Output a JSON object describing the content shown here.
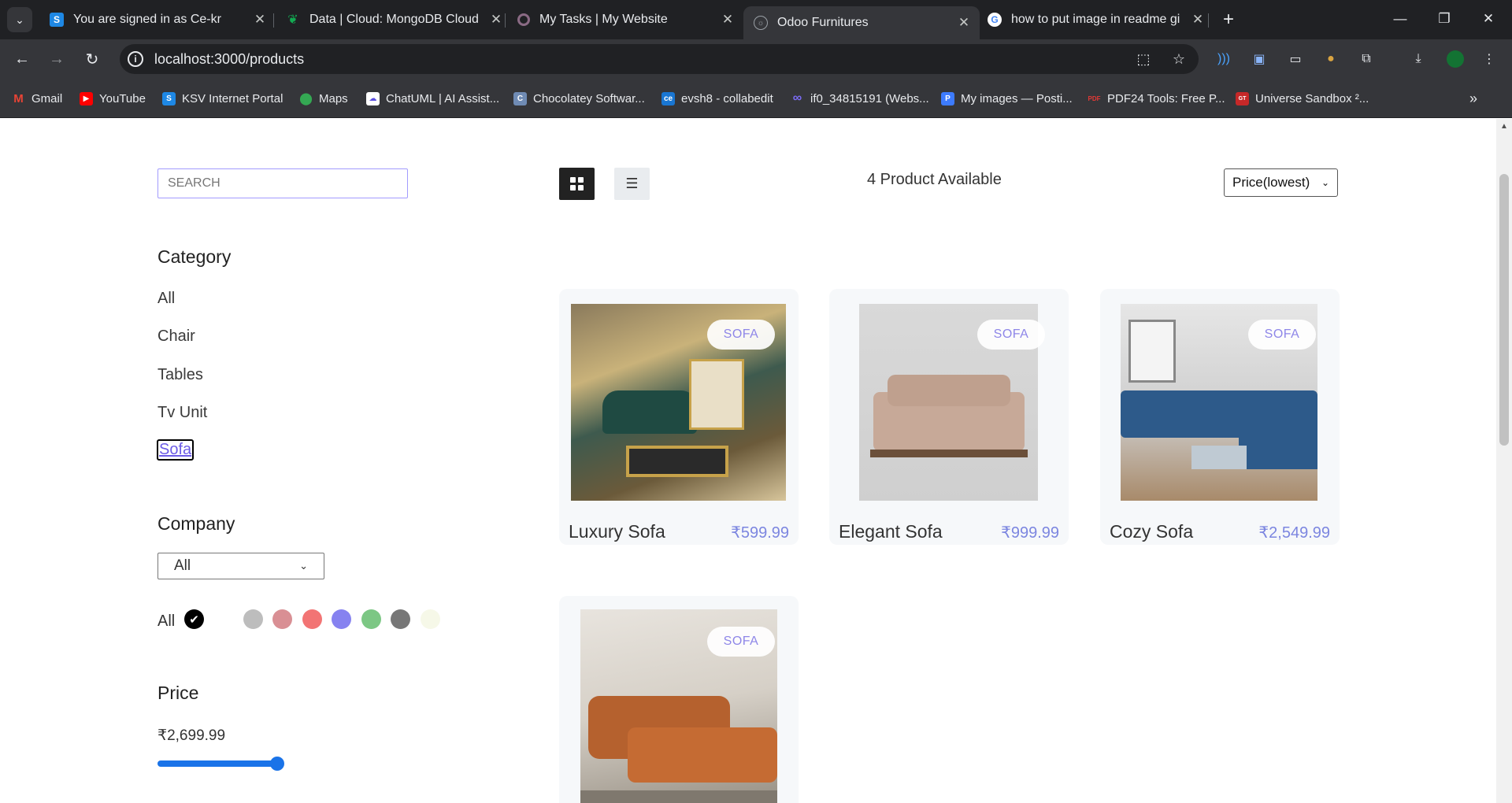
{
  "browser": {
    "tabs": [
      {
        "title": "You are signed in as Ce-kr",
        "active": false
      },
      {
        "title": "Data | Cloud: MongoDB Cloud",
        "active": false
      },
      {
        "title": "My Tasks | My Website",
        "active": false
      },
      {
        "title": "Odoo Furnitures",
        "active": true
      },
      {
        "title": "how to put image in readme gi",
        "active": false
      }
    ],
    "url": "localhost:3000/products",
    "bookmarks": [
      {
        "label": "Gmail"
      },
      {
        "label": "YouTube"
      },
      {
        "label": "KSV Internet Portal"
      },
      {
        "label": "Maps"
      },
      {
        "label": "ChatUML | AI Assist..."
      },
      {
        "label": "Chocolatey Softwar..."
      },
      {
        "label": "evsh8 - collabedit"
      },
      {
        "label": "if0_34815191 (Webs..."
      },
      {
        "label": "My images — Posti..."
      },
      {
        "label": "PDF24 Tools: Free P..."
      },
      {
        "label": "Universe Sandbox ²..."
      }
    ]
  },
  "filters": {
    "search_placeholder": "SEARCH",
    "category_heading": "Category",
    "categories": [
      "All",
      "Chair",
      "Tables",
      "Tv Unit",
      "Sofa"
    ],
    "active_category": "Sofa",
    "company_heading": "Company",
    "company_selected": "All",
    "colors_all_label": "All",
    "colors": [
      "#000000",
      "#bdbdbd",
      "#d98f94",
      "#f27474",
      "#8682f0",
      "#7cc784",
      "#777777",
      "#f6f8e8"
    ],
    "price_heading": "Price",
    "price_value": "₹2,699.99",
    "price_slider_fraction": 1.0
  },
  "products_header": {
    "count_text": "4 Product Available",
    "sort_selected": "Price(lowest)"
  },
  "products": [
    {
      "name": "Luxury Sofa",
      "price": "₹599.99",
      "category": "SOFA"
    },
    {
      "name": "Elegant Sofa",
      "price": "₹999.99",
      "category": "SOFA"
    },
    {
      "name": "Cozy Sofa",
      "price": "₹2,549.99",
      "category": "SOFA"
    },
    {
      "name": "",
      "price": "",
      "category": "SOFA"
    }
  ]
}
